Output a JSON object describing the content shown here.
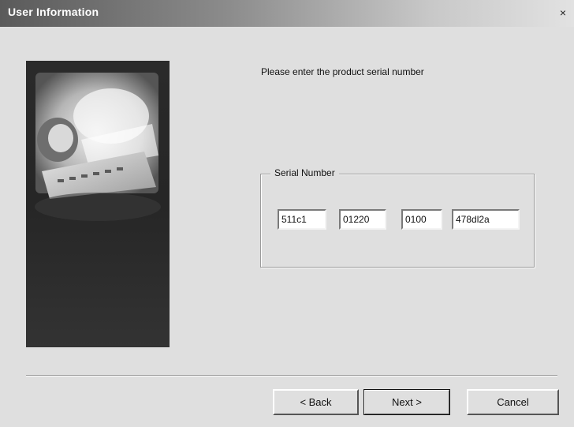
{
  "window": {
    "title": "User Information",
    "close_glyph": "×"
  },
  "main": {
    "prompt": "Please enter the product serial number",
    "serial_group": {
      "legend": "Serial Number",
      "fields": [
        "511c1",
        "01220",
        "0100",
        "478dl2a"
      ]
    }
  },
  "buttons": {
    "back": "< Back",
    "next": "Next >",
    "cancel": "Cancel"
  },
  "icons": {
    "close": "close-icon",
    "wizard_image": "wizard-side-image"
  }
}
